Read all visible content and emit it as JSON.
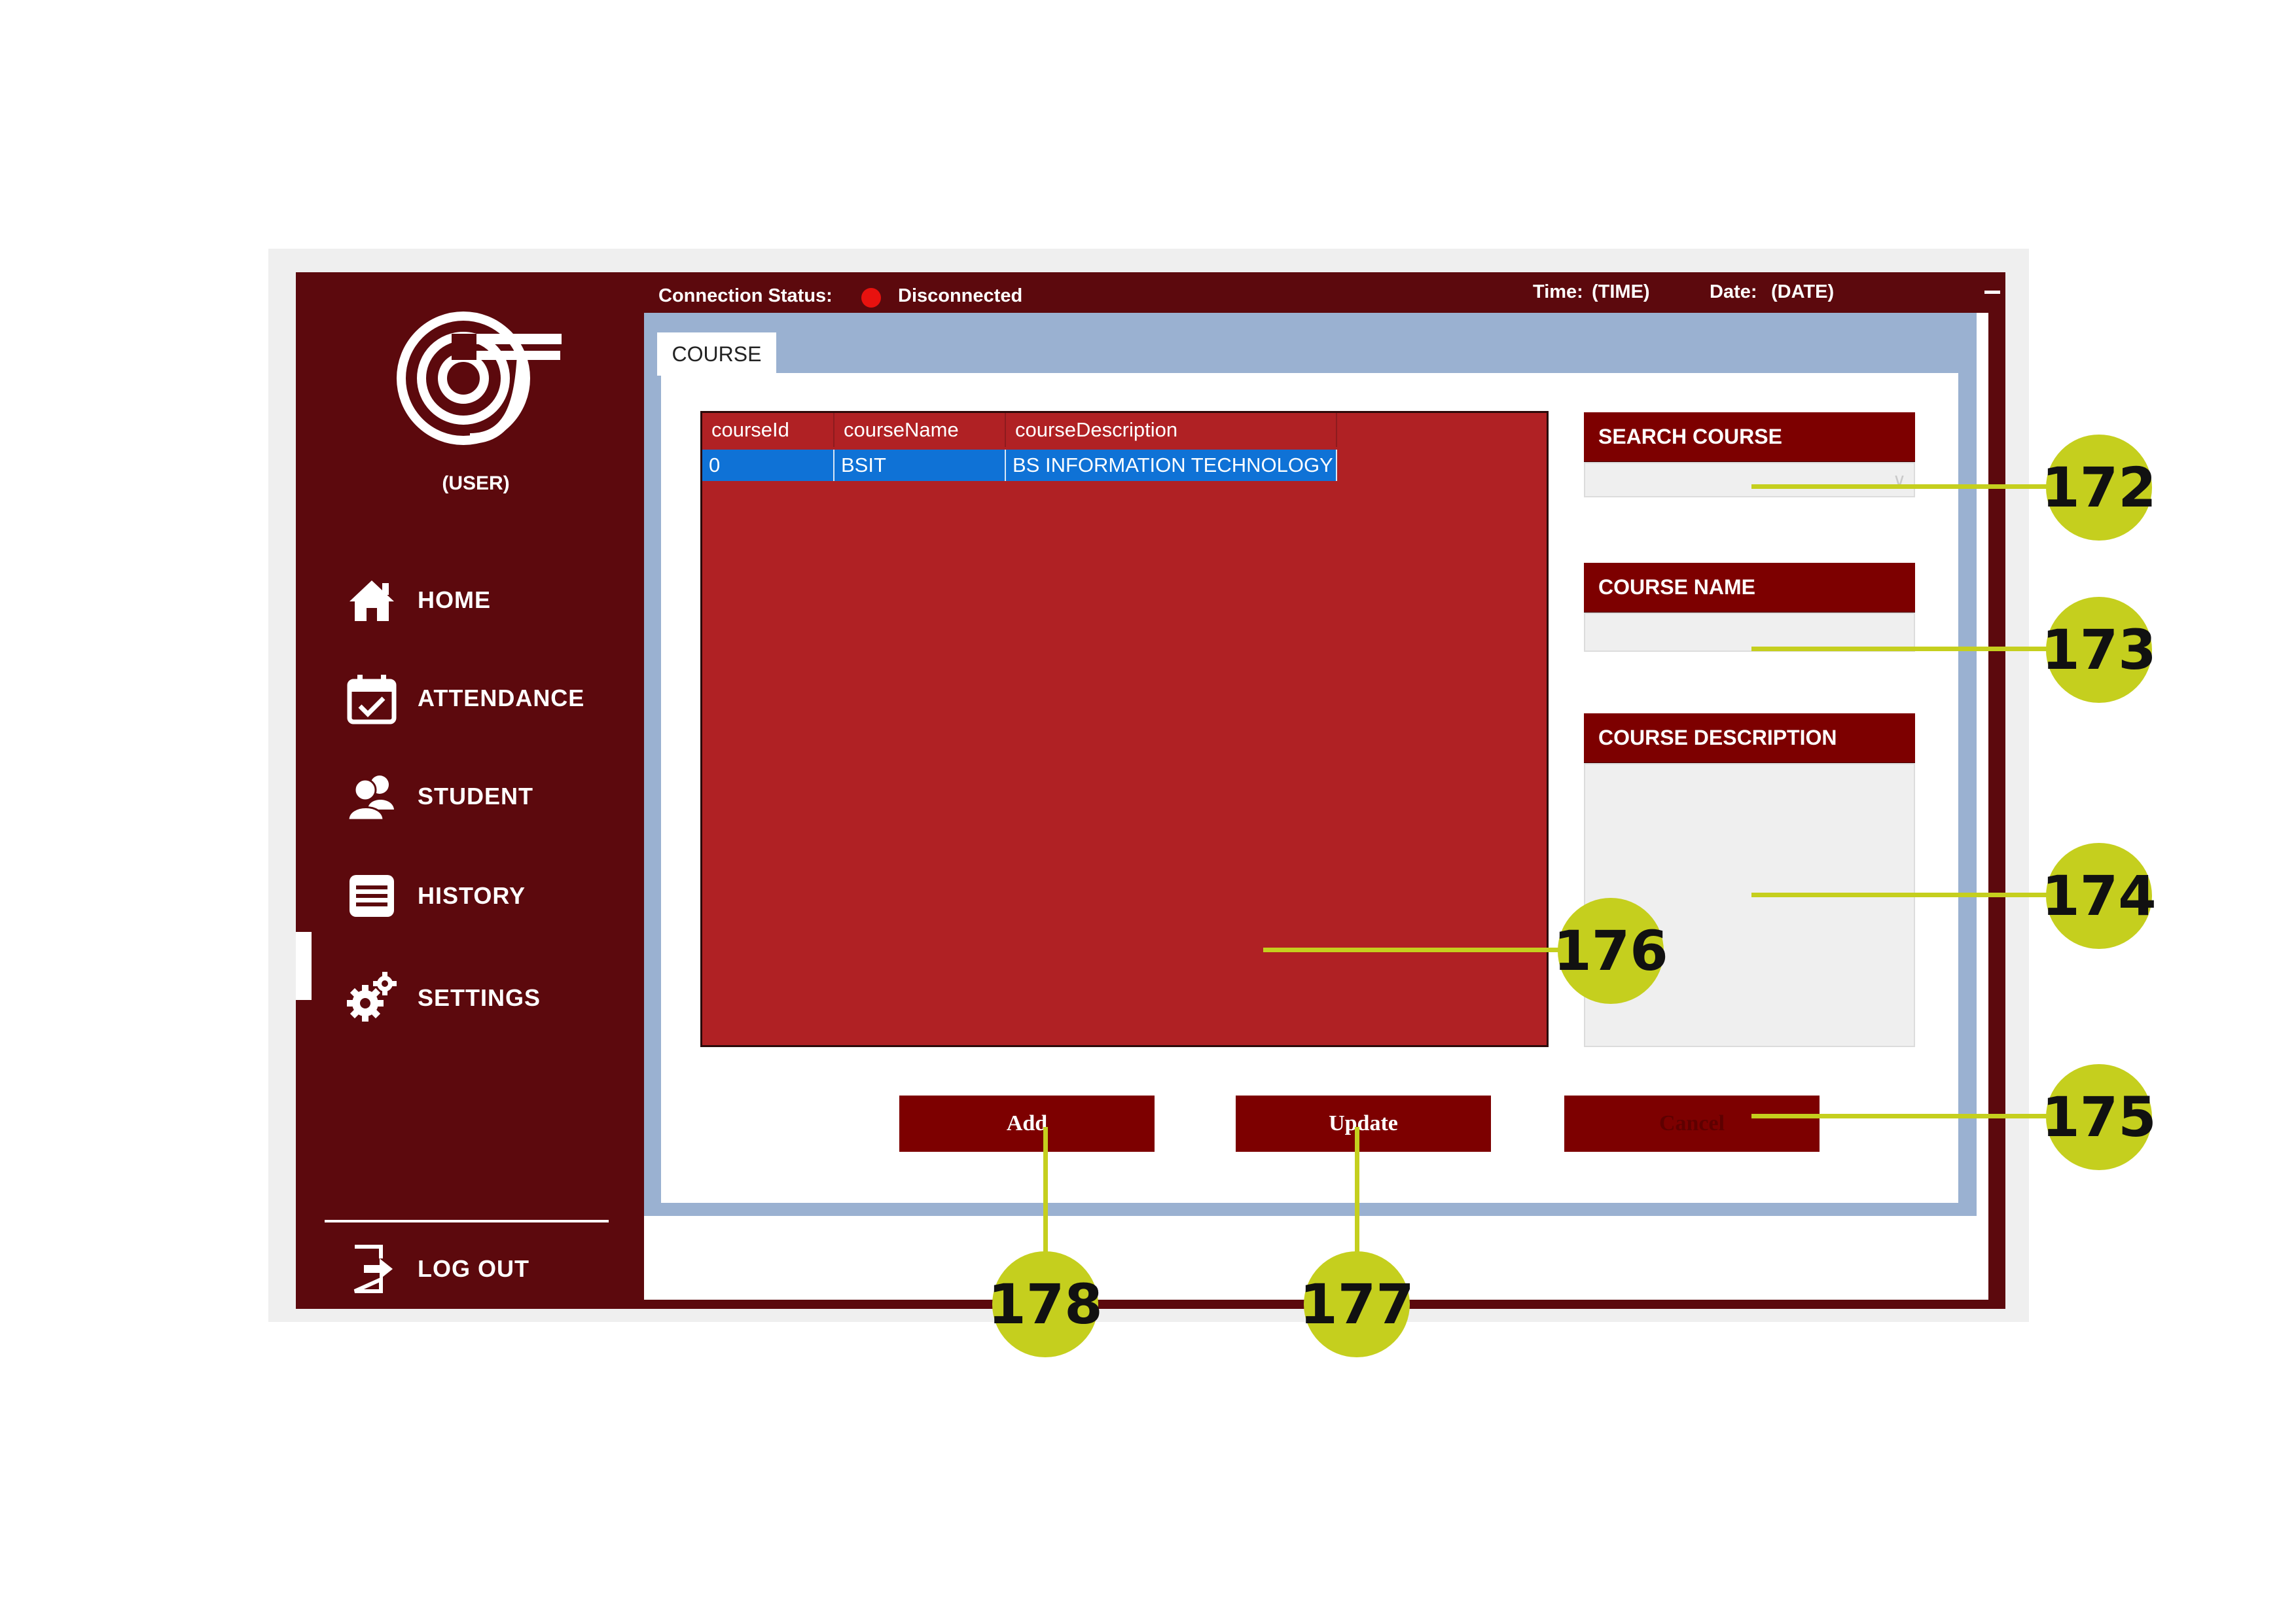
{
  "sidebar": {
    "logo": "college-logo",
    "user": "(USER)",
    "items": [
      {
        "label": "HOME",
        "icon": "home-icon"
      },
      {
        "label": "ATTENDANCE",
        "icon": "calendar-check-icon"
      },
      {
        "label": "STUDENT",
        "icon": "users-icon"
      },
      {
        "label": "HISTORY",
        "icon": "list-icon"
      },
      {
        "label": "SETTINGS",
        "icon": "gears-icon"
      }
    ],
    "active": "SETTINGS",
    "logout": "LOG OUT"
  },
  "topbar": {
    "connection_label": "Connection Status:",
    "connection_value": "Disconnected",
    "status_color": "#e8120f",
    "time_label": "Time:",
    "time_value": "(TIME)",
    "date_label": "Date:",
    "date_value": "(DATE)",
    "minimize": "–"
  },
  "tab": "COURSE",
  "grid": {
    "columns": [
      "courseId",
      "courseName",
      "courseDescription"
    ],
    "rows": [
      [
        "0",
        "BSIT",
        "BS INFORMATION TECHNOLOGY"
      ]
    ],
    "selected_row": 0
  },
  "fields": {
    "search": {
      "label": "SEARCH COURSE",
      "value": ""
    },
    "name": {
      "label": "COURSE NAME",
      "value": ""
    },
    "description": {
      "label": "COURSE DESCRIPTION",
      "value": ""
    }
  },
  "buttons": {
    "add": "Add",
    "update": "Update",
    "cancel": "Cancel"
  },
  "callouts": [
    "172",
    "173",
    "174",
    "175",
    "176",
    "177",
    "178"
  ],
  "colors": {
    "sidebar": "#5c090d",
    "accent": "#7d0000",
    "grid": "#b02124",
    "selection": "#0f72d6",
    "callout": "#c5cf1e"
  }
}
